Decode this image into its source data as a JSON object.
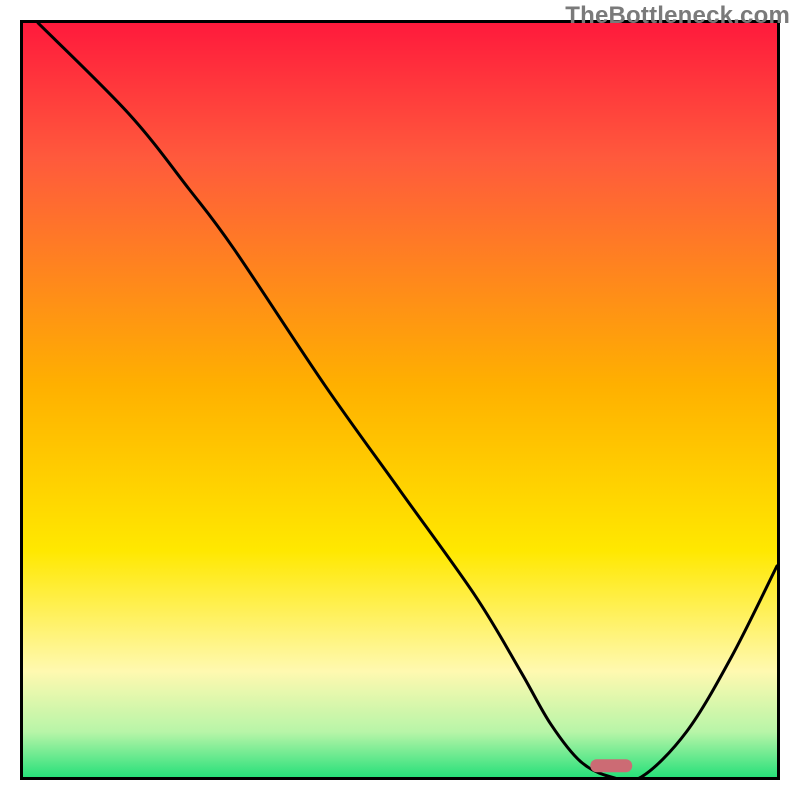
{
  "watermark": "TheBottleneck.com",
  "chart_data": {
    "type": "line",
    "title": "",
    "xlabel": "",
    "ylabel": "",
    "xlim": [
      0,
      100
    ],
    "ylim": [
      0,
      100
    ],
    "grid": false,
    "legend": false,
    "background_gradient": [
      "#ff1a3c",
      "#ff5a3c",
      "#ffb000",
      "#ffe800",
      "#fff9b0",
      "#b8f5a8",
      "#28e07a"
    ],
    "series": [
      {
        "name": "curve",
        "x": [
          2,
          14,
          22,
          28,
          40,
          50,
          60,
          66,
          70,
          74,
          78,
          82,
          88,
          94,
          100
        ],
        "y": [
          100,
          88,
          78,
          70,
          52,
          38,
          24,
          14,
          7,
          2,
          0,
          0,
          6,
          16,
          28
        ]
      }
    ],
    "marker": {
      "x": 78,
      "y": 1.5,
      "width_pct": 5.5,
      "height_pct": 1.8,
      "color": "#cc6b74"
    }
  }
}
